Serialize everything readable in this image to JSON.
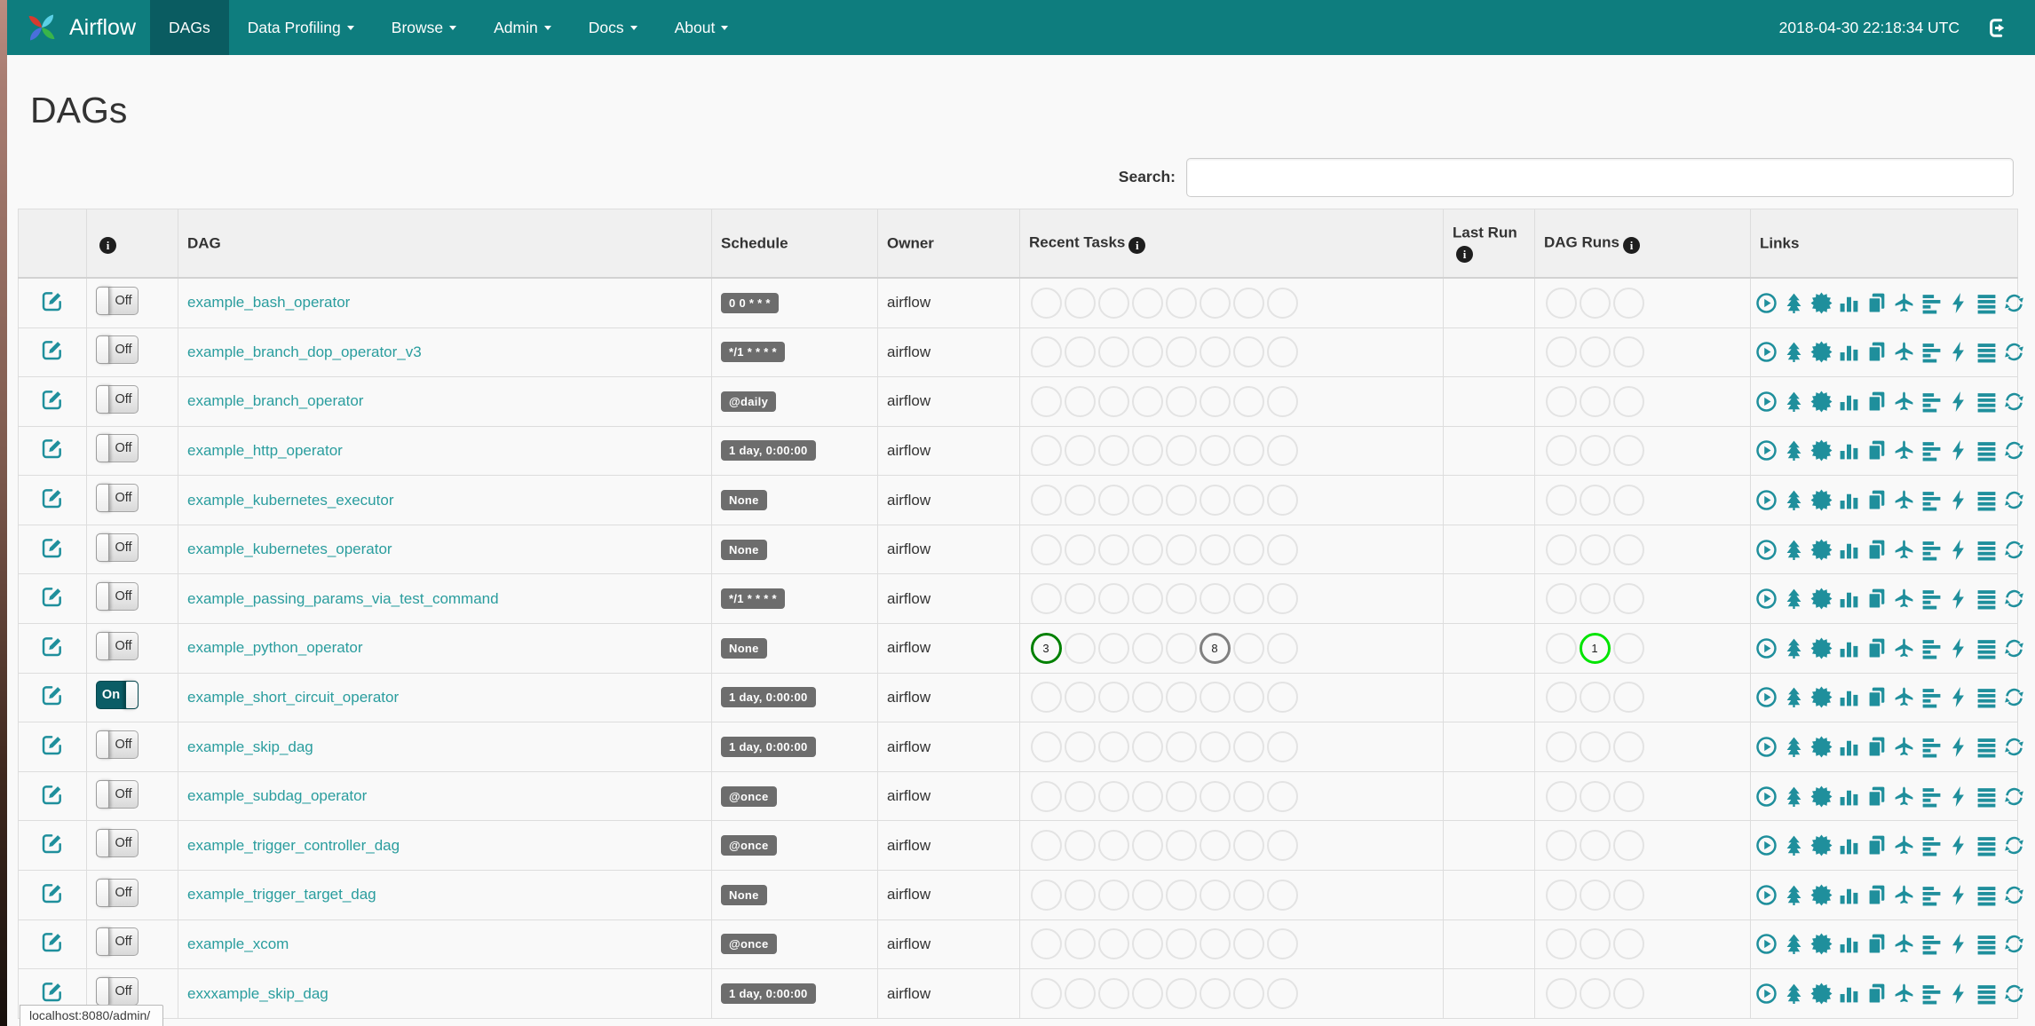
{
  "navbar": {
    "brand": "Airflow",
    "items": [
      {
        "label": "DAGs",
        "active": true,
        "caret": false
      },
      {
        "label": "Data Profiling",
        "active": false,
        "caret": true
      },
      {
        "label": "Browse",
        "active": false,
        "caret": true
      },
      {
        "label": "Admin",
        "active": false,
        "caret": true
      },
      {
        "label": "Docs",
        "active": false,
        "caret": true
      },
      {
        "label": "About",
        "active": false,
        "caret": true
      }
    ],
    "clock": "2018-04-30 22:18:34 UTC"
  },
  "page": {
    "title": "DAGs",
    "search_label": "Search:",
    "search_value": "",
    "status_bar": "localhost:8080/admin/"
  },
  "colors": {
    "navbar_teal": "#0e7d7e",
    "navbar_active_teal": "#0a5c61",
    "accent_teal": "#1f8f9c",
    "link_teal": "#2a9d9e",
    "badge_gray": "#6d6d6d",
    "success": "#008000",
    "queued": "#808080",
    "running": "#00e400"
  },
  "table": {
    "headers": {
      "dag": "DAG",
      "schedule": "Schedule",
      "owner": "Owner",
      "recent_tasks": "Recent Tasks",
      "last_run": "Last Run",
      "dag_runs": "DAG Runs",
      "links": "Links"
    },
    "links_icons": [
      "play-circle",
      "tree",
      "starburst",
      "bar-chart",
      "pages",
      "plane",
      "gantt",
      "bolt",
      "align-justify",
      "refresh"
    ],
    "rows": [
      {
        "name": "example_bash_operator",
        "toggle": "Off",
        "schedule": "0 0 * * *",
        "owner": "airflow",
        "recent_tasks": [
          null,
          null,
          null,
          null,
          null,
          null,
          null,
          null
        ],
        "last_run": "",
        "dag_runs": [
          null,
          null,
          null
        ]
      },
      {
        "name": "example_branch_dop_operator_v3",
        "toggle": "Off",
        "schedule": "*/1 * * * *",
        "owner": "airflow",
        "recent_tasks": [
          null,
          null,
          null,
          null,
          null,
          null,
          null,
          null
        ],
        "last_run": "",
        "dag_runs": [
          null,
          null,
          null
        ]
      },
      {
        "name": "example_branch_operator",
        "toggle": "Off",
        "schedule": "@daily",
        "owner": "airflow",
        "recent_tasks": [
          null,
          null,
          null,
          null,
          null,
          null,
          null,
          null
        ],
        "last_run": "",
        "dag_runs": [
          null,
          null,
          null
        ]
      },
      {
        "name": "example_http_operator",
        "toggle": "Off",
        "schedule": "1 day, 0:00:00",
        "owner": "airflow",
        "recent_tasks": [
          null,
          null,
          null,
          null,
          null,
          null,
          null,
          null
        ],
        "last_run": "",
        "dag_runs": [
          null,
          null,
          null
        ]
      },
      {
        "name": "example_kubernetes_executor",
        "toggle": "Off",
        "schedule": "None",
        "owner": "airflow",
        "recent_tasks": [
          null,
          null,
          null,
          null,
          null,
          null,
          null,
          null
        ],
        "last_run": "",
        "dag_runs": [
          null,
          null,
          null
        ]
      },
      {
        "name": "example_kubernetes_operator",
        "toggle": "Off",
        "schedule": "None",
        "owner": "airflow",
        "recent_tasks": [
          null,
          null,
          null,
          null,
          null,
          null,
          null,
          null
        ],
        "last_run": "",
        "dag_runs": [
          null,
          null,
          null
        ]
      },
      {
        "name": "example_passing_params_via_test_command",
        "toggle": "Off",
        "schedule": "*/1 * * * *",
        "owner": "airflow",
        "recent_tasks": [
          null,
          null,
          null,
          null,
          null,
          null,
          null,
          null
        ],
        "last_run": "",
        "dag_runs": [
          null,
          null,
          null
        ]
      },
      {
        "name": "example_python_operator",
        "toggle": "Off",
        "schedule": "None",
        "owner": "airflow",
        "recent_tasks": [
          {
            "count": 3,
            "state": "success"
          },
          null,
          null,
          null,
          null,
          {
            "count": 8,
            "state": "queued"
          },
          null,
          null
        ],
        "last_run": "",
        "dag_runs": [
          null,
          {
            "count": 1,
            "state": "running"
          },
          null
        ]
      },
      {
        "name": "example_short_circuit_operator",
        "toggle": "On",
        "schedule": "1 day, 0:00:00",
        "owner": "airflow",
        "recent_tasks": [
          null,
          null,
          null,
          null,
          null,
          null,
          null,
          null
        ],
        "last_run": "",
        "dag_runs": [
          null,
          null,
          null
        ]
      },
      {
        "name": "example_skip_dag",
        "toggle": "Off",
        "schedule": "1 day, 0:00:00",
        "owner": "airflow",
        "recent_tasks": [
          null,
          null,
          null,
          null,
          null,
          null,
          null,
          null
        ],
        "last_run": "",
        "dag_runs": [
          null,
          null,
          null
        ]
      },
      {
        "name": "example_subdag_operator",
        "toggle": "Off",
        "schedule": "@once",
        "owner": "airflow",
        "recent_tasks": [
          null,
          null,
          null,
          null,
          null,
          null,
          null,
          null
        ],
        "last_run": "",
        "dag_runs": [
          null,
          null,
          null
        ]
      },
      {
        "name": "example_trigger_controller_dag",
        "toggle": "Off",
        "schedule": "@once",
        "owner": "airflow",
        "recent_tasks": [
          null,
          null,
          null,
          null,
          null,
          null,
          null,
          null
        ],
        "last_run": "",
        "dag_runs": [
          null,
          null,
          null
        ]
      },
      {
        "name": "example_trigger_target_dag",
        "toggle": "Off",
        "schedule": "None",
        "owner": "airflow",
        "recent_tasks": [
          null,
          null,
          null,
          null,
          null,
          null,
          null,
          null
        ],
        "last_run": "",
        "dag_runs": [
          null,
          null,
          null
        ]
      },
      {
        "name": "example_xcom",
        "toggle": "Off",
        "schedule": "@once",
        "owner": "airflow",
        "recent_tasks": [
          null,
          null,
          null,
          null,
          null,
          null,
          null,
          null
        ],
        "last_run": "",
        "dag_runs": [
          null,
          null,
          null
        ]
      },
      {
        "name": "exxxample_skip_dag",
        "toggle": "Off",
        "schedule": "1 day, 0:00:00",
        "owner": "airflow",
        "recent_tasks": [
          null,
          null,
          null,
          null,
          null,
          null,
          null,
          null
        ],
        "last_run": "",
        "dag_runs": [
          null,
          null,
          null
        ]
      }
    ]
  }
}
